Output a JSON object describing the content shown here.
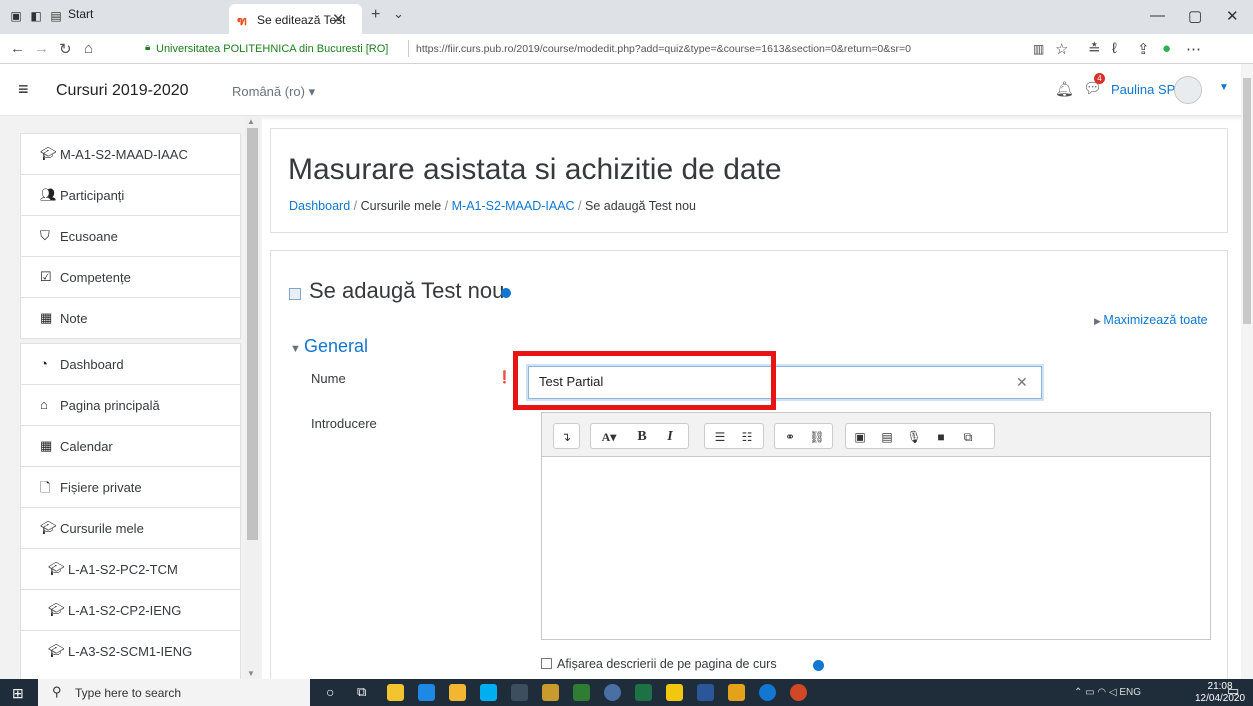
{
  "browser": {
    "tabs": [
      {
        "label": "Start"
      },
      {
        "label": "Se editează Test"
      }
    ],
    "site_identity": "Universitatea POLITEHNICA din Bucuresti [RO]",
    "url": "https://fiir.curs.pub.ro/2019/course/modedit.php?add=quiz&type=&course=1613&section=0&return=0&sr=0"
  },
  "navbar": {
    "site_name": "Cursuri 2019-2020",
    "language": "Română (ro) ▾",
    "message_count": "4",
    "user_name": "Paulina SPANU"
  },
  "sidebar": {
    "block1": [
      {
        "label": "M-A1-S2-MAAD-IAAC",
        "icon": "graduation-cap-icon"
      },
      {
        "label": "Participanți",
        "icon": "users-icon"
      },
      {
        "label": "Ecusoane",
        "icon": "shield-icon"
      },
      {
        "label": "Competențe",
        "icon": "checkbox-icon"
      },
      {
        "label": "Note",
        "icon": "table-icon"
      }
    ],
    "block2": [
      {
        "label": "Dashboard",
        "icon": "dashboard-icon"
      },
      {
        "label": "Pagina principală",
        "icon": "home-icon"
      },
      {
        "label": "Calendar",
        "icon": "calendar-icon"
      },
      {
        "label": "Fișiere private",
        "icon": "file-icon"
      },
      {
        "label": "Cursurile mele",
        "icon": "graduation-cap-icon"
      },
      {
        "label": "L-A1-S2-PC2-TCM",
        "icon": "graduation-cap-icon"
      },
      {
        "label": "L-A1-S2-CP2-IENG",
        "icon": "graduation-cap-icon"
      },
      {
        "label": "L-A3-S2-SCM1-IENG",
        "icon": "graduation-cap-icon"
      }
    ]
  },
  "page": {
    "title": "Masurare asistata si achizitie de date",
    "breadcrumb": [
      "Dashboard",
      "Cursurile mele",
      "M-A1-S2-MAAD-IAAC",
      "Se adaugă Test nou"
    ],
    "form_heading": "Se adaugă Test nou",
    "expand_all": "Maximizează toate",
    "section_general": "General",
    "name_label": "Nume",
    "name_value": "Test Partial",
    "intro_label": "Introducere",
    "show_description": "Afișarea descrierii de pe pagina de curs"
  },
  "taskbar": {
    "search_placeholder": "Type here to search",
    "language": "ENG",
    "time": "21:08",
    "date": "12/04/2020",
    "notifications": "2"
  }
}
